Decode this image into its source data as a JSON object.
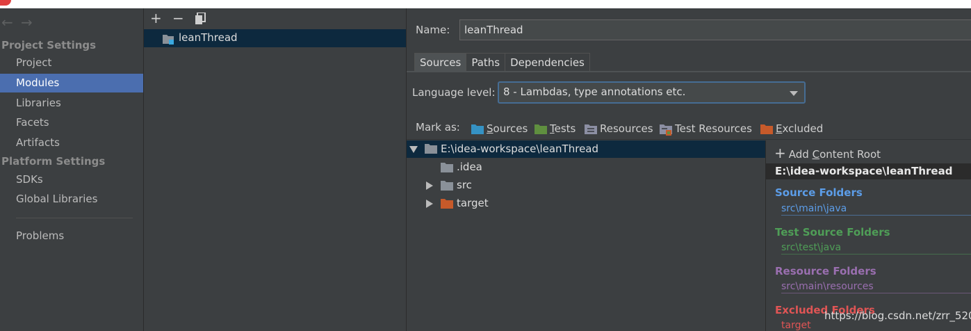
{
  "colors": {
    "sources": "#3592c4",
    "tests": "#5f8f3f",
    "resources": "#8c8fa3",
    "excluded": "#c75a2a",
    "source_folders": "#5c9de8",
    "test_folders": "#4f9e57",
    "resource_folders": "#9a6fb0",
    "excluded_folders": "#e05555",
    "selection": "#4b6eaf"
  },
  "sidebar": {
    "back_icon": "arrow-left-icon",
    "forward_icon": "arrow-right-icon",
    "project_settings_title": "Project Settings",
    "project_settings_items": [
      "Project",
      "Modules",
      "Libraries",
      "Facets",
      "Artifacts"
    ],
    "selected_item": "Modules",
    "platform_settings_title": "Platform Settings",
    "platform_settings_items": [
      "SDKs",
      "Global Libraries"
    ],
    "problems_label": "Problems"
  },
  "module_list": {
    "toolbar": {
      "add": "+",
      "remove": "−",
      "copy_icon": "copy-icon"
    },
    "modules": [
      "leanThread"
    ]
  },
  "module_settings": {
    "name_label": "Name:",
    "name_value": "leanThread",
    "tabs": [
      "Sources",
      "Paths",
      "Dependencies"
    ],
    "active_tab": "Sources",
    "language_level_label": "Language level:",
    "language_level_value": "8 - Lambdas, type annotations etc.",
    "mark_as_label": "Mark as:",
    "mark_as": {
      "sources": {
        "mnemonic": "S",
        "rest": "ources"
      },
      "tests": {
        "mnemonic": "T",
        "rest": "ests"
      },
      "resources": "Resources",
      "test_resources": "Test Resources",
      "excluded": {
        "mnemonic": "E",
        "rest": "xcluded"
      }
    }
  },
  "tree": {
    "root": "E:\\idea-workspace\\leanThread",
    "children": [
      ".idea",
      "src",
      "target"
    ]
  },
  "content_root": {
    "add_label_pre": "Add ",
    "add_label_mnemonic": "C",
    "add_label_post": "ontent Root",
    "root_path": "E:\\idea-workspace\\leanThread",
    "source_folders_title": "Source Folders",
    "source_folders_path": "src\\main\\java",
    "test_folders_title": "Test Source Folders",
    "test_folders_path": "src\\test\\java",
    "resource_folders_title": "Resource Folders",
    "resource_folders_path": "src\\main\\resources",
    "excluded_folders_title": "Excluded Folders",
    "excluded_folders_path": "target"
  },
  "watermark": "https://blog.csdn.net/zrr_520"
}
